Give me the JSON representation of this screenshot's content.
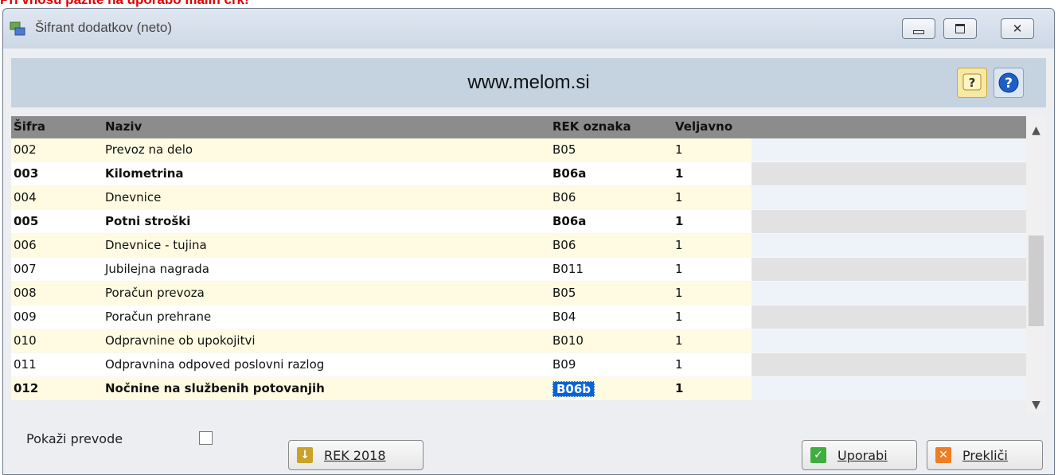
{
  "banner": "Pri vnosu pazite na uporabo malih črk!",
  "window": {
    "title": "Šifrant dodatkov (neto)",
    "controls": {
      "minimize": "▭",
      "maximize": "▣",
      "close": "✕"
    }
  },
  "header": {
    "title": "www.melom.si"
  },
  "grid": {
    "columns": {
      "code": "Šifra",
      "name": "Naziv",
      "rek": "REK oznaka",
      "valid": "Veljavno"
    },
    "rows": [
      {
        "code": "002",
        "name": "Prevoz na delo",
        "rek": "B05",
        "valid": "1",
        "bold": false
      },
      {
        "code": "003",
        "name": "Kilometrina",
        "rek": "B06a",
        "valid": "1",
        "bold": true
      },
      {
        "code": "004",
        "name": "Dnevnice",
        "rek": "B06",
        "valid": "1",
        "bold": false
      },
      {
        "code": "005",
        "name": "Potni stroški",
        "rek": "B06a",
        "valid": "1",
        "bold": true
      },
      {
        "code": "006",
        "name": "Dnevnice - tujina",
        "rek": "B06",
        "valid": "1",
        "bold": false
      },
      {
        "code": "007",
        "name": "Jubilejna nagrada",
        "rek": "B011",
        "valid": "1",
        "bold": false
      },
      {
        "code": "008",
        "name": "Poračun prevoza",
        "rek": "B05",
        "valid": "1",
        "bold": false
      },
      {
        "code": "009",
        "name": "Poračun prehrane",
        "rek": "B04",
        "valid": "1",
        "bold": false
      },
      {
        "code": "010",
        "name": "Odpravnine ob upokojitvi",
        "rek": "B010",
        "valid": "1",
        "bold": false
      },
      {
        "code": "011",
        "name": "Odpravnina odpoved poslovni razlog",
        "rek": "B09",
        "valid": "1",
        "bold": false
      },
      {
        "code": "012",
        "name": "Nočnine na službenih potovanjih",
        "rek": "B06b",
        "valid": "1",
        "bold": true,
        "selected_cell": "rek"
      }
    ]
  },
  "footer": {
    "show_translations_label": "Pokaži prevode",
    "show_translations_checked": false,
    "rek_button": "REK 2018",
    "apply_button": "Uporabi",
    "cancel_button": "Prekliči"
  },
  "icons": {
    "help_question": "question-mark-icon",
    "help_circle": "help-circle-icon",
    "rek_icon": "download-arrow-icon",
    "apply_icon": "checkmark-icon",
    "cancel_icon": "x-icon"
  },
  "colors": {
    "banner": "#e00000",
    "row_yellow": "#fefbe2",
    "row_white": "#ffffff",
    "rest_light": "#eef2f9",
    "rest_gray": "#e2e2e2",
    "selection": "#0a64d6"
  }
}
